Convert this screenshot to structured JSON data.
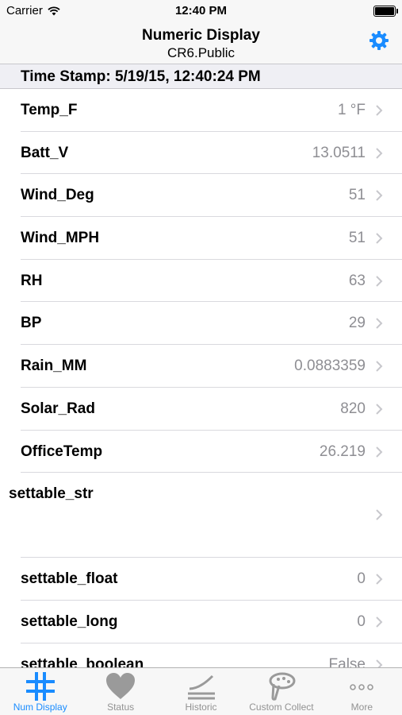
{
  "status_bar": {
    "carrier": "Carrier",
    "time": "12:40 PM"
  },
  "nav": {
    "title": "Numeric Display",
    "subtitle": "CR6.Public",
    "settings_icon": "gear-icon",
    "accent_color": "#1a8cff"
  },
  "timestamp": {
    "text": "Time Stamp: 5/19/15, 12:40:24 PM"
  },
  "rows": [
    {
      "label": "Temp_F",
      "value": "1 °F"
    },
    {
      "label": "Batt_V",
      "value": "13.0511"
    },
    {
      "label": "Wind_Deg",
      "value": "51"
    },
    {
      "label": "Wind_MPH",
      "value": "51"
    },
    {
      "label": "RH",
      "value": "63"
    },
    {
      "label": "BP",
      "value": "29"
    },
    {
      "label": "Rain_MM",
      "value": "0.0883359"
    },
    {
      "label": "Solar_Rad",
      "value": "820"
    },
    {
      "label": "OfficeTemp",
      "value": "26.219"
    },
    {
      "label": "settable_str",
      "value": ""
    },
    {
      "label": "settable_float",
      "value": "0"
    },
    {
      "label": "settable_long",
      "value": "0"
    },
    {
      "label": "settable_boolean",
      "value": "False"
    }
  ],
  "tabs": [
    {
      "label": "Num Display",
      "icon": "grid-icon",
      "active": true
    },
    {
      "label": "Status",
      "icon": "heart-icon",
      "active": false
    },
    {
      "label": "Historic",
      "icon": "historic-icon",
      "active": false
    },
    {
      "label": "Custom Collect",
      "icon": "custom-collect-icon",
      "active": false
    },
    {
      "label": "More",
      "icon": "more-icon",
      "active": false
    }
  ]
}
